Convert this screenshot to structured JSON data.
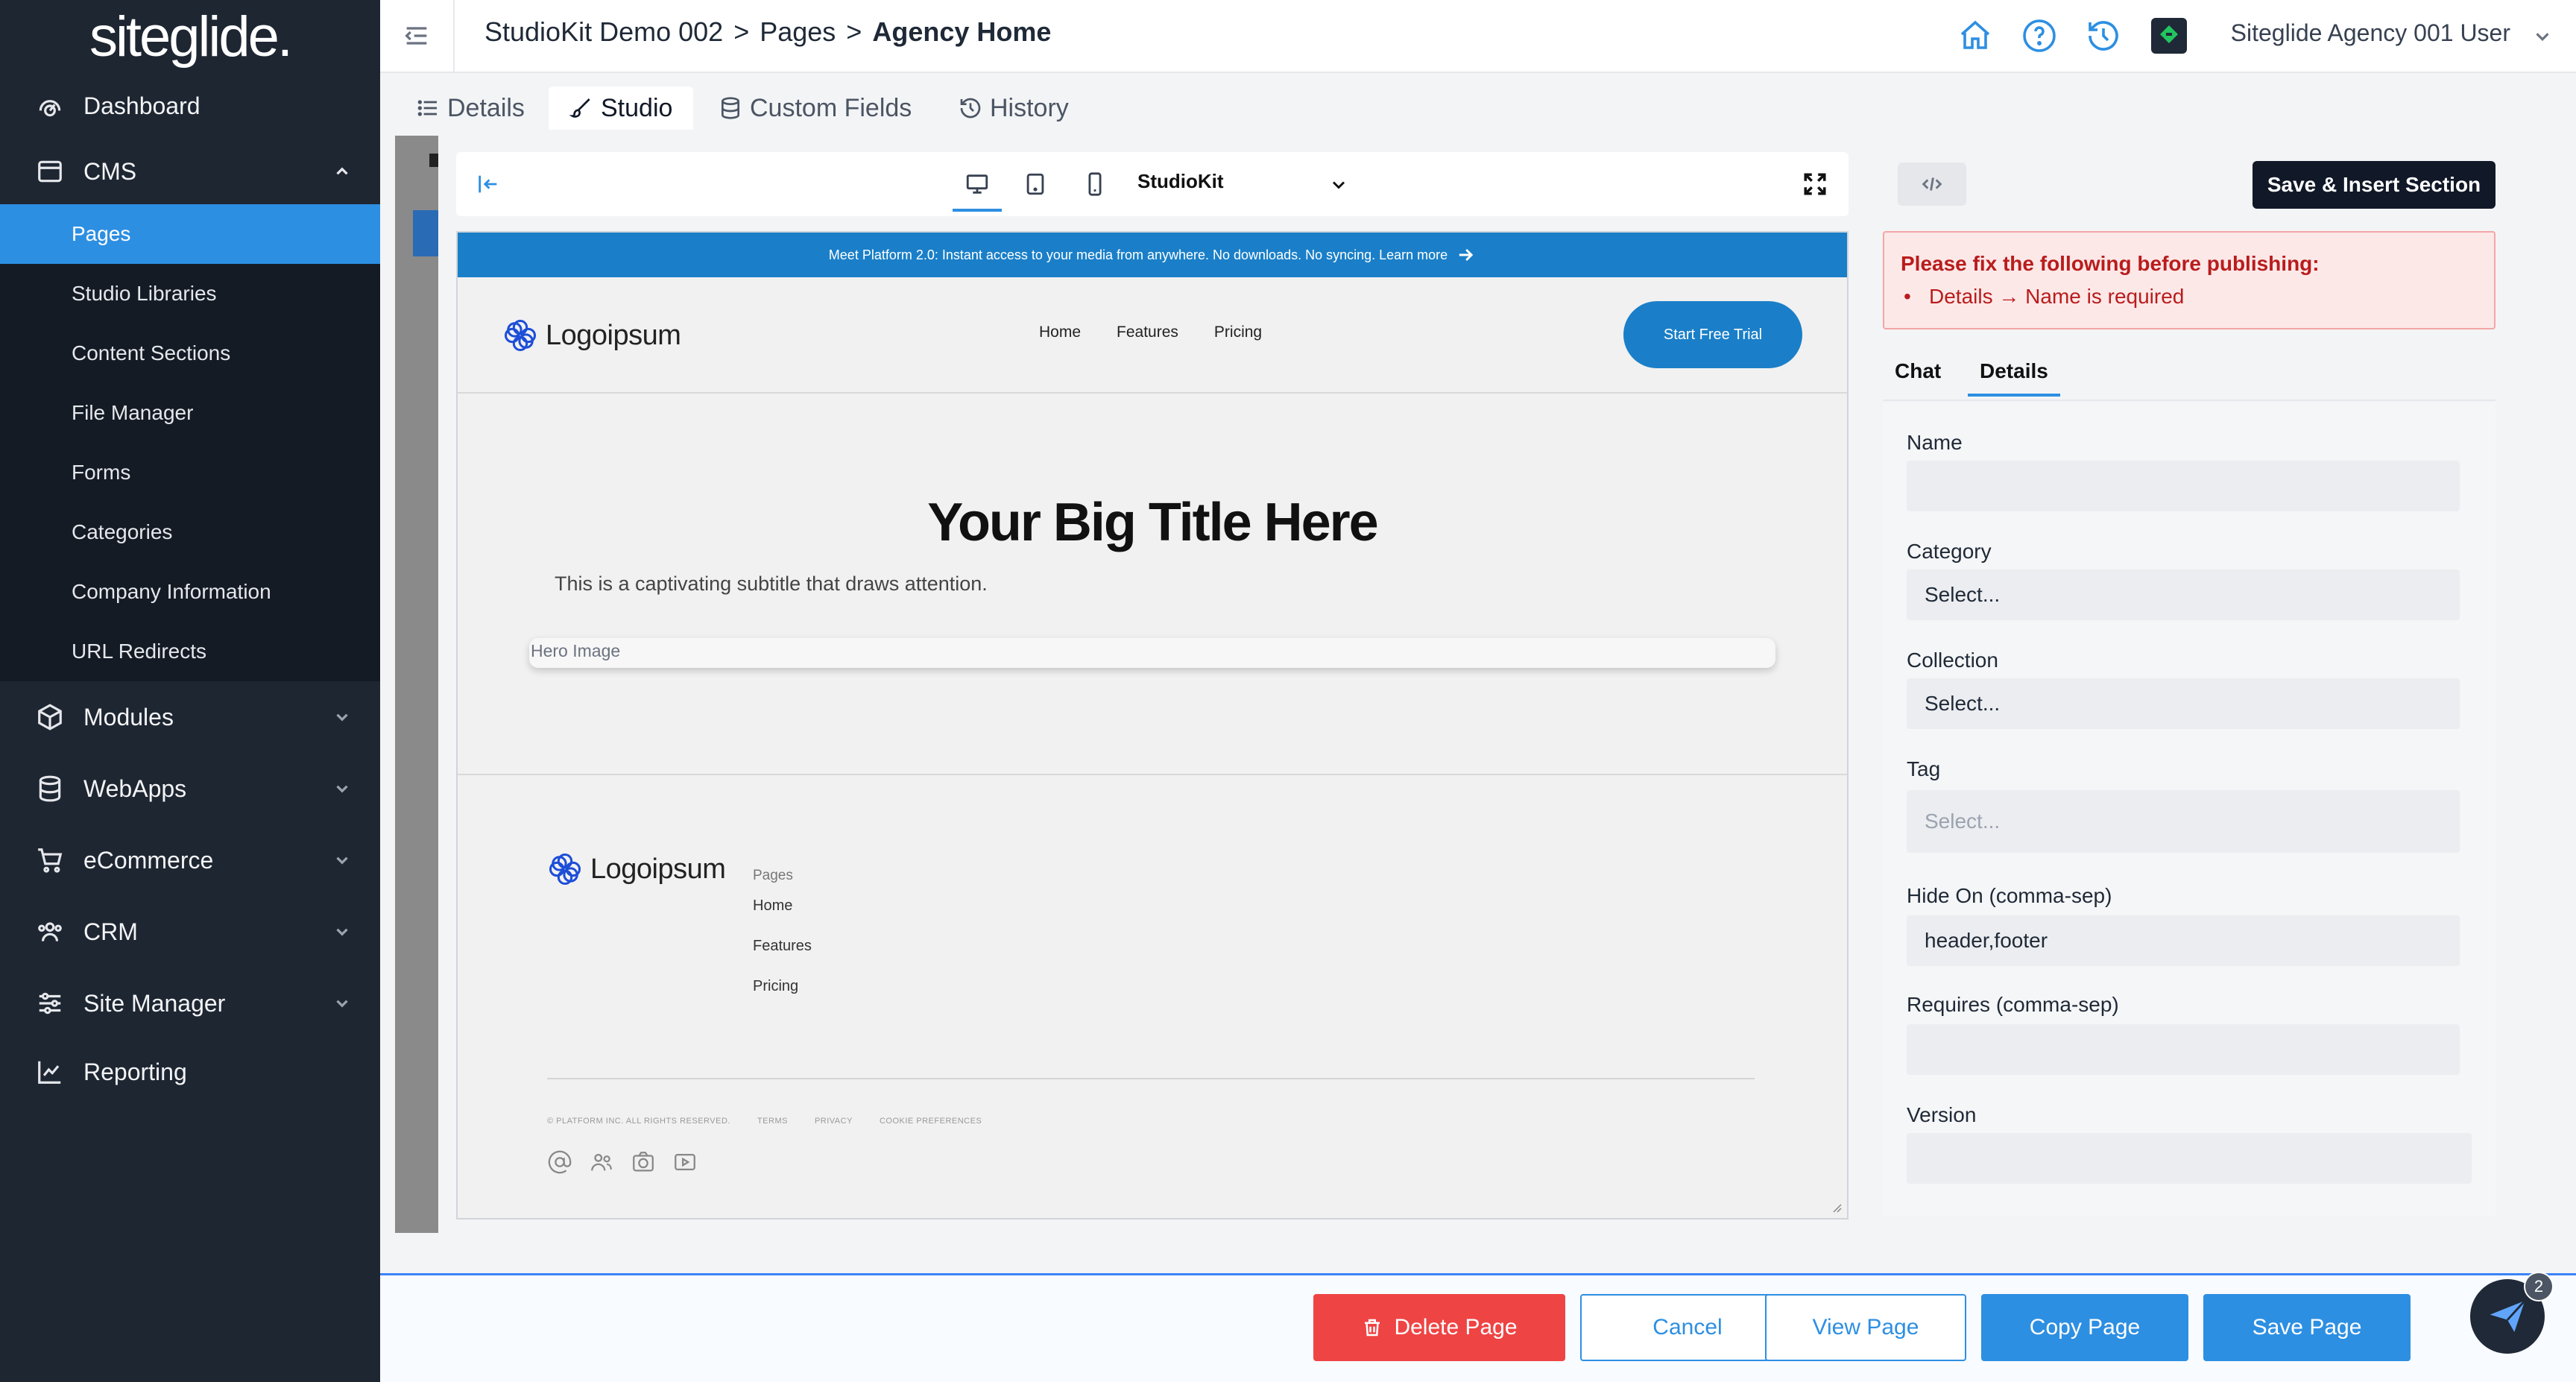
{
  "sidebar": {
    "logo": "siteglide.",
    "items": [
      {
        "label": "Dashboard",
        "icon": "gauge-icon"
      },
      {
        "label": "CMS",
        "icon": "window-icon",
        "expanded": true
      },
      {
        "label": "Modules",
        "icon": "cube-icon"
      },
      {
        "label": "WebApps",
        "icon": "database-icon"
      },
      {
        "label": "eCommerce",
        "icon": "cart-icon"
      },
      {
        "label": "CRM",
        "icon": "users-icon"
      },
      {
        "label": "Site Manager",
        "icon": "sliders-icon"
      },
      {
        "label": "Reporting",
        "icon": "chart-line-icon"
      }
    ],
    "cms_sub": [
      {
        "label": "Pages",
        "active": true
      },
      {
        "label": "Studio Libraries"
      },
      {
        "label": "Content Sections"
      },
      {
        "label": "File Manager"
      },
      {
        "label": "Forms"
      },
      {
        "label": "Categories"
      },
      {
        "label": "Company Information"
      },
      {
        "label": "URL Redirects"
      }
    ]
  },
  "topbar": {
    "breadcrumb": [
      "StudioKit Demo 002",
      ">",
      "Pages",
      ">",
      "Agency Home"
    ],
    "user": "Siteglide Agency 001 User"
  },
  "tabs": [
    "Details",
    "Studio",
    "Custom Fields",
    "History"
  ],
  "canvas_toolbar": {
    "kit": "StudioKit",
    "device": "desktop"
  },
  "preview": {
    "announcement": "Meet Platform 2.0: Instant access to your media from anywhere. No downloads. No syncing. Learn more",
    "logo": "Logoipsum",
    "nav": [
      "Home",
      "Features",
      "Pricing"
    ],
    "cta": "Start Free Trial",
    "hero_title": "Your Big Title Here",
    "hero_subtitle": "This is a captivating subtitle that draws attention.",
    "hero_image_alt": "Hero Image",
    "footer_logo": "Logoipsum",
    "footer_heading": "Pages",
    "footer_links": [
      "Home",
      "Features",
      "Pricing"
    ],
    "footer_legal": [
      "© PLATFORM INC. ALL RIGHTS RESERVED.",
      "TERMS",
      "PRIVACY",
      "COOKIE PREFERENCES"
    ]
  },
  "panel": {
    "save_insert": "Save & Insert Section",
    "error_title": "Please fix the following before publishing:",
    "error_item": "Details → Name is required",
    "tabs": [
      "Chat",
      "Details"
    ],
    "active_tab": "Details",
    "fields": {
      "name_label": "Name",
      "name_value": "",
      "category_label": "Category",
      "category_value": "Select...",
      "collection_label": "Collection",
      "collection_value": "Select...",
      "tag_label": "Tag",
      "tag_placeholder": "Select...",
      "hide_on_label": "Hide On (comma-sep)",
      "hide_on_value": "header,footer",
      "requires_label": "Requires (comma-sep)",
      "requires_value": "",
      "version_label": "Version",
      "version_value": ""
    }
  },
  "bottom": {
    "delete": "Delete Page",
    "cancel": "Cancel",
    "view": "View Page",
    "copy": "Copy Page",
    "save": "Save Page",
    "chat_badge": "2"
  },
  "colors": {
    "sidebar": "#1e2632",
    "accent": "#2d8fe2",
    "danger": "#ef4444"
  }
}
